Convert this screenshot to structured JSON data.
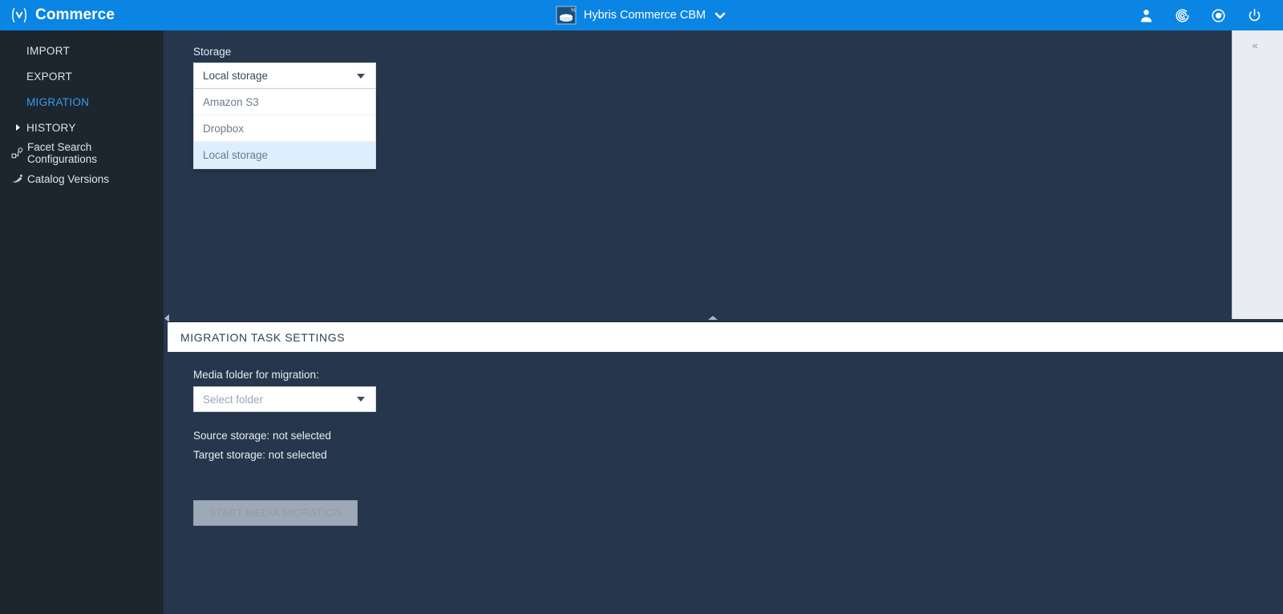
{
  "topbar": {
    "brand": "Commerce",
    "brand_icon": "hybris-logo-icon",
    "center_icon": "database-icon",
    "center_label": "Hybris Commerce CBM",
    "caret_icon": "chevron-down-icon",
    "actions": [
      {
        "name": "user-icon",
        "label": ""
      },
      {
        "name": "spiral-refresh-icon",
        "label": ""
      },
      {
        "name": "clock-icon",
        "label": ""
      },
      {
        "name": "power-icon",
        "label": ""
      }
    ],
    "accent_color": "#0b85e3"
  },
  "sidebar": {
    "bg_color": "#1c262f",
    "active_color": "#3c9ae8",
    "items": [
      {
        "label": "IMPORT",
        "icon": null,
        "arrow": false,
        "active": false
      },
      {
        "label": "EXPORT",
        "icon": null,
        "arrow": false,
        "active": false
      },
      {
        "label": "MIGRATION",
        "icon": null,
        "arrow": false,
        "active": true
      },
      {
        "label": "HISTORY",
        "icon": null,
        "arrow": true,
        "active": false
      },
      {
        "label": "Facet Search Configurations",
        "icon": "facet-search-icon",
        "arrow": false,
        "active": false
      },
      {
        "label": "Catalog Versions",
        "icon": "catalog-versions-icon",
        "arrow": false,
        "active": false
      }
    ]
  },
  "main": {
    "storage": {
      "label": "Storage",
      "selected": "Local storage",
      "options": [
        {
          "label": "Amazon S3",
          "selected": false
        },
        {
          "label": "Dropbox",
          "selected": false
        },
        {
          "label": "Local storage",
          "selected": true
        }
      ],
      "caret_icon": "dropdown-caret-icon",
      "highlight_color": "#ddeefc"
    },
    "collapse_icon": "«"
  },
  "panel": {
    "title": "MIGRATION TASK SETTINGS",
    "folder_label": "Media folder for migration:",
    "folder_placeholder": "Select folder",
    "folder_value": "",
    "source_storage": "Source storage: not selected",
    "target_storage": "Target storage: not selected",
    "cta_label": "START MEDIA MIGRATION"
  }
}
